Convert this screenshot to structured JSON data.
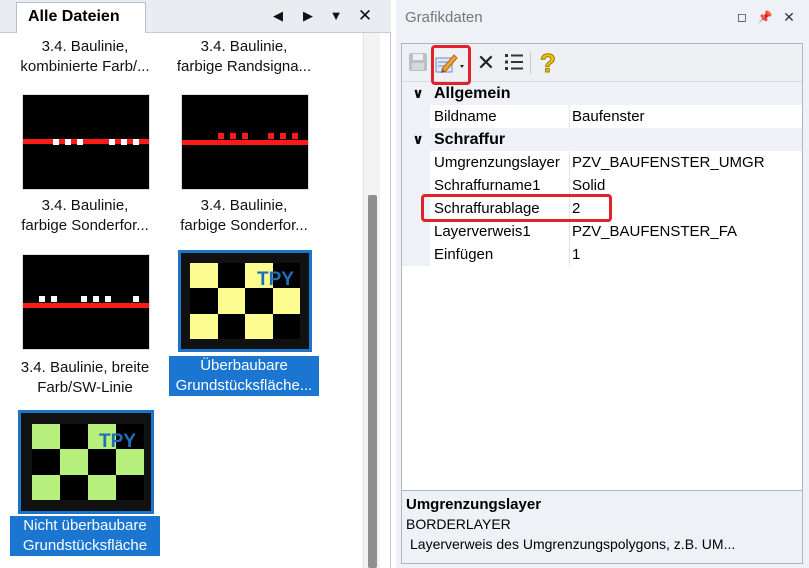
{
  "left_panel": {
    "tab_label": "Alle Dateien",
    "tiles": [
      {
        "line1": "3.4. Baulinie,",
        "line2": "kombinierte Farb/..."
      },
      {
        "line1": "3.4. Baulinie,",
        "line2": "farbige Randsigna..."
      },
      {
        "line1": "3.4. Baulinie,",
        "line2": "farbige Sonderfor..."
      },
      {
        "line1": "3.4. Baulinie,",
        "line2": "farbige Sonderfor..."
      },
      {
        "line1": "3.4. Baulinie, breite",
        "line2": "Farb/SW-Linie"
      },
      {
        "line1": "Überbaubare",
        "line2": "Grundstücksfläche...",
        "thumb_text": "TPY"
      },
      {
        "line1": "Nicht überbaubare",
        "line2": "Grundstücksfläche",
        "thumb_text": "TPY"
      }
    ]
  },
  "right_panel": {
    "title": "Grafikdaten",
    "categories": [
      {
        "label": "Allgemein",
        "properties": [
          {
            "name": "Bildname",
            "value": "Baufenster"
          }
        ]
      },
      {
        "label": "Schraffur",
        "properties": [
          {
            "name": "Umgrenzungslayer",
            "value": "PZV_BAUFENSTER_UMGR"
          },
          {
            "name": "Schraffurname1",
            "value": "Solid"
          },
          {
            "name": "Schraffurablage",
            "value": "2"
          },
          {
            "name": "Layerverweis1",
            "value": "PZV_BAUFENSTER_FA"
          },
          {
            "name": "Einfügen",
            "value": "1"
          }
        ]
      }
    ],
    "description": {
      "title": "Umgrenzungslayer",
      "subtitle": "BORDERLAYER",
      "text": "Layerverweis des Umgrenzungspolygons, z.B. UM..."
    }
  },
  "colors": {
    "selection": "#1b76d1",
    "highlight": "#e0222c",
    "line_red": "#ff1a1a",
    "hatch_yellow": "#fcfc90",
    "hatch_green": "#b8f07e",
    "tpy_blue": "#1d6fb8"
  },
  "icons": [
    "save-icon",
    "edit-icon",
    "delete-icon",
    "list-icon",
    "help-icon",
    "arrow-left-icon",
    "arrow-right-icon",
    "chevron-down-icon",
    "close-icon",
    "pin-icon",
    "restore-icon"
  ]
}
